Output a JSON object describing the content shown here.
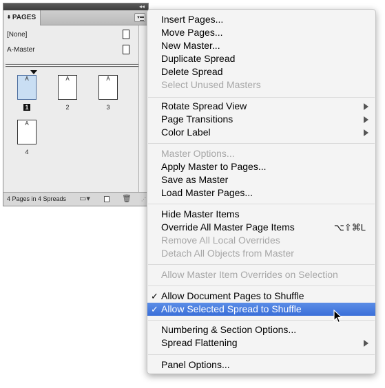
{
  "panel": {
    "tab_label": "PAGES",
    "masters": [
      "[None]",
      "A-Master"
    ],
    "pages": [
      {
        "number": "1",
        "master": "A",
        "selected": true
      },
      {
        "number": "2",
        "master": "A",
        "selected": false
      },
      {
        "number": "3",
        "master": "A",
        "selected": false
      },
      {
        "number": "4",
        "master": "A",
        "selected": false
      }
    ],
    "status": "4 Pages in 4 Spreads"
  },
  "menu": {
    "items": [
      {
        "label": "Insert Pages..."
      },
      {
        "label": "Move Pages..."
      },
      {
        "label": "New Master..."
      },
      {
        "label": "Duplicate Spread"
      },
      {
        "label": "Delete Spread"
      },
      {
        "label": "Select Unused Masters",
        "disabled": true
      },
      {
        "label": "Rotate Spread View",
        "submenu": true
      },
      {
        "label": "Page Transitions",
        "submenu": true
      },
      {
        "label": "Color Label",
        "submenu": true
      },
      {
        "label": "Master Options...",
        "disabled": true
      },
      {
        "label": "Apply Master to Pages..."
      },
      {
        "label": "Save as Master"
      },
      {
        "label": "Load Master Pages..."
      },
      {
        "label": "Hide Master Items"
      },
      {
        "label": "Override All Master Page Items",
        "shortcut": "⌥⇧⌘L"
      },
      {
        "label": "Remove All Local Overrides",
        "disabled": true
      },
      {
        "label": "Detach All Objects from Master",
        "disabled": true
      },
      {
        "label": "Allow Master Item Overrides on Selection",
        "disabled": true
      },
      {
        "label": "Allow Document Pages to Shuffle",
        "checked": true
      },
      {
        "label": "Allow Selected Spread to Shuffle",
        "checked": true,
        "highlighted": true
      },
      {
        "label": "Numbering & Section Options..."
      },
      {
        "label": "Spread Flattening",
        "submenu": true
      },
      {
        "label": "Panel Options..."
      }
    ],
    "check_glyph": "✓"
  }
}
